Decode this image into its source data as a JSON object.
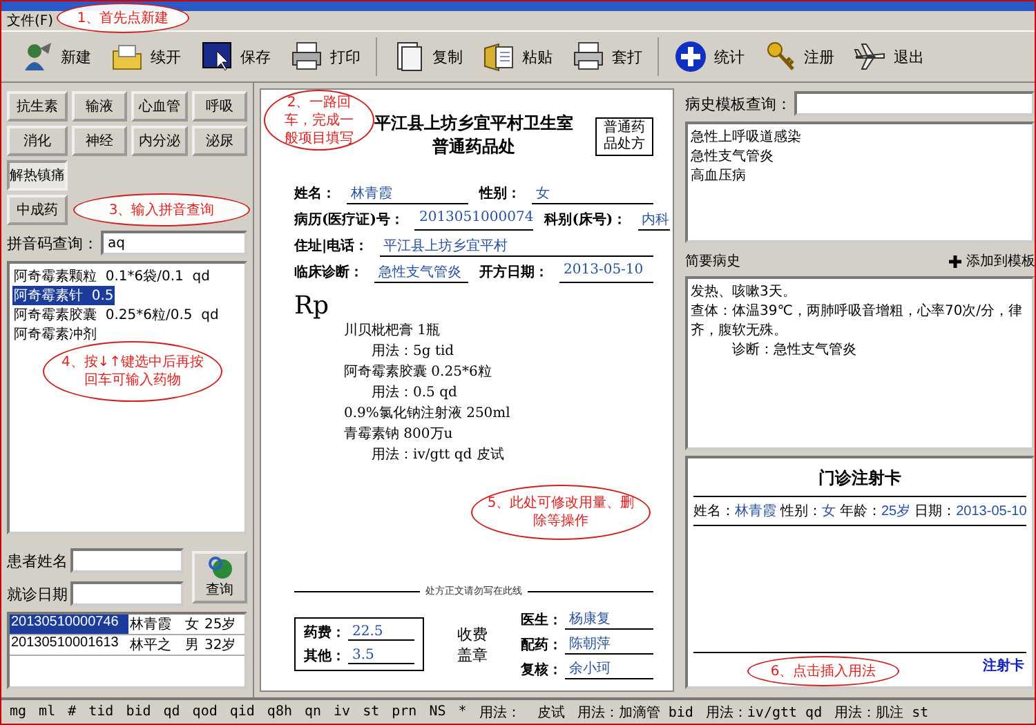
{
  "menu": [
    {
      "label": "文件(F)"
    }
  ],
  "toolbar": [
    {
      "label": "新建"
    },
    {
      "label": "续开"
    },
    {
      "label": "保存"
    },
    {
      "label": "打印"
    },
    {
      "label": "复制"
    },
    {
      "label": "粘贴"
    },
    {
      "label": "套打"
    },
    {
      "label": "统计"
    },
    {
      "label": "注册"
    },
    {
      "label": "退出"
    }
  ],
  "categories": [
    {
      "label": "抗生素",
      "selected": false
    },
    {
      "label": "输液",
      "selected": false
    },
    {
      "label": "心血管",
      "selected": false
    },
    {
      "label": "呼吸",
      "selected": false
    },
    {
      "label": "消化",
      "selected": false
    },
    {
      "label": "神经",
      "selected": false
    },
    {
      "label": "内分泌",
      "selected": false
    },
    {
      "label": "泌尿",
      "selected": false
    },
    {
      "label": "解热镇痛",
      "selected": true
    },
    {
      "label": "中成药",
      "selected": false
    }
  ],
  "pinyin_search": {
    "label": "拼音码查询：",
    "value": "aq"
  },
  "drug_list": [
    {
      "text": "阿奇霉素颗粒  0.1*6袋/0.1  qd",
      "selected": false
    },
    {
      "text": "阿奇霉素针  0.5",
      "selected": true
    },
    {
      "text": "阿奇霉素胶囊  0.25*6粒/0.5  qd",
      "selected": false
    },
    {
      "text": "阿奇霉素冲剂",
      "selected": false
    }
  ],
  "patient_search": {
    "name_label": "患者姓名",
    "date_label": "就诊日期",
    "button": "查询"
  },
  "patients": [
    {
      "id": "20130510000746",
      "name": "林青霞",
      "sex": "女",
      "age": "25岁",
      "selected": true
    },
    {
      "id": "20130510001613",
      "name": "林平之",
      "sex": "男",
      "age": "32岁",
      "selected": false
    }
  ],
  "prescription": {
    "clinic": "平江县上坊乡宜平村卫生室",
    "title": "普通药品处",
    "stamp": "普通药品处方",
    "fields": [
      [
        {
          "label": "姓名：",
          "value": "林青霞"
        },
        {
          "label": "性别：",
          "value": "女"
        }
      ],
      [
        {
          "label": "病历(医疗证)号：",
          "value": "2013051000074"
        },
        {
          "label": "科别(床号)：",
          "value": "内科"
        }
      ],
      [
        {
          "label": "住址|电话：",
          "value": "平江县上坊乡宜平村"
        }
      ],
      [
        {
          "label": "临床诊断：",
          "value": "急性支气管炎"
        },
        {
          "label": "开方日期：",
          "value": "2013-05-10"
        }
      ]
    ],
    "rp": "Rp",
    "items": [
      {
        "kind": "drug",
        "text": "川贝枇杷膏  1瓶"
      },
      {
        "kind": "usage",
        "text": "用法：5g tid"
      },
      {
        "kind": "drug",
        "text": "阿奇霉素胶囊  0.25*6粒"
      },
      {
        "kind": "usage",
        "text": "用法：0.5   qd"
      },
      {
        "kind": "drug",
        "text": "0.9%氯化钠注射液  250ml"
      },
      {
        "kind": "drug",
        "text": "青霉素钠  800万u"
      },
      {
        "kind": "usage",
        "text": "用法：iv/gtt qd 皮试"
      }
    ],
    "divider_note": "处方正文请勿写在此线",
    "fees": [
      {
        "label": "药费：",
        "value": "22.5"
      },
      {
        "label": "其他：",
        "value": "3.5"
      }
    ],
    "seal": [
      "收费",
      "盖章"
    ],
    "staff": [
      {
        "label": "医生：",
        "value": "杨康复"
      },
      {
        "label": "配药：",
        "value": "陈朝萍"
      },
      {
        "label": "复核：",
        "value": "余小珂"
      }
    ]
  },
  "history_search": {
    "label": "病史模板查询："
  },
  "history_templates": [
    "急性上呼吸道感染",
    "急性支气管炎",
    "高血压病"
  ],
  "brief_history": {
    "title": "简要病史",
    "add_button": "添加到模板",
    "lines": [
      "发热、咳嗽3天。",
      "查体：体温39℃，两肺呼吸音增粗，心率70次/分，律齐，腹软无殊。",
      "诊断：急性支气管炎"
    ]
  },
  "injection_card": {
    "title": "门诊注射卡",
    "fields": [
      {
        "label": "姓名：",
        "value": "林青霞"
      },
      {
        "label": "性别：",
        "value": "女"
      },
      {
        "label": "年龄：",
        "value": "25岁"
      },
      {
        "label": "日期：",
        "value": "2013-05-10"
      }
    ],
    "button": "注射卡"
  },
  "usage_bar": [
    "mg",
    "ml",
    "#",
    "tid",
    "bid",
    "qd",
    "qod",
    "qid",
    "q8h",
    "qn",
    "iv",
    "st",
    "prn",
    "NS",
    "*",
    "用法：  皮试",
    "用法：加滴管 bid",
    "用法：iv/gtt qd",
    "用法：肌注 st"
  ],
  "callouts": [
    {
      "text": "1、首先点新建"
    },
    {
      "text": "2、一路回车，完成一般项目填写"
    },
    {
      "text": "3、输入拼音查询"
    },
    {
      "text": "4、按↓↑键选中后再按回车可输入药物"
    },
    {
      "text": "5、此处可修改用量、删除等操作"
    },
    {
      "text": "6、点击插入用法"
    }
  ]
}
